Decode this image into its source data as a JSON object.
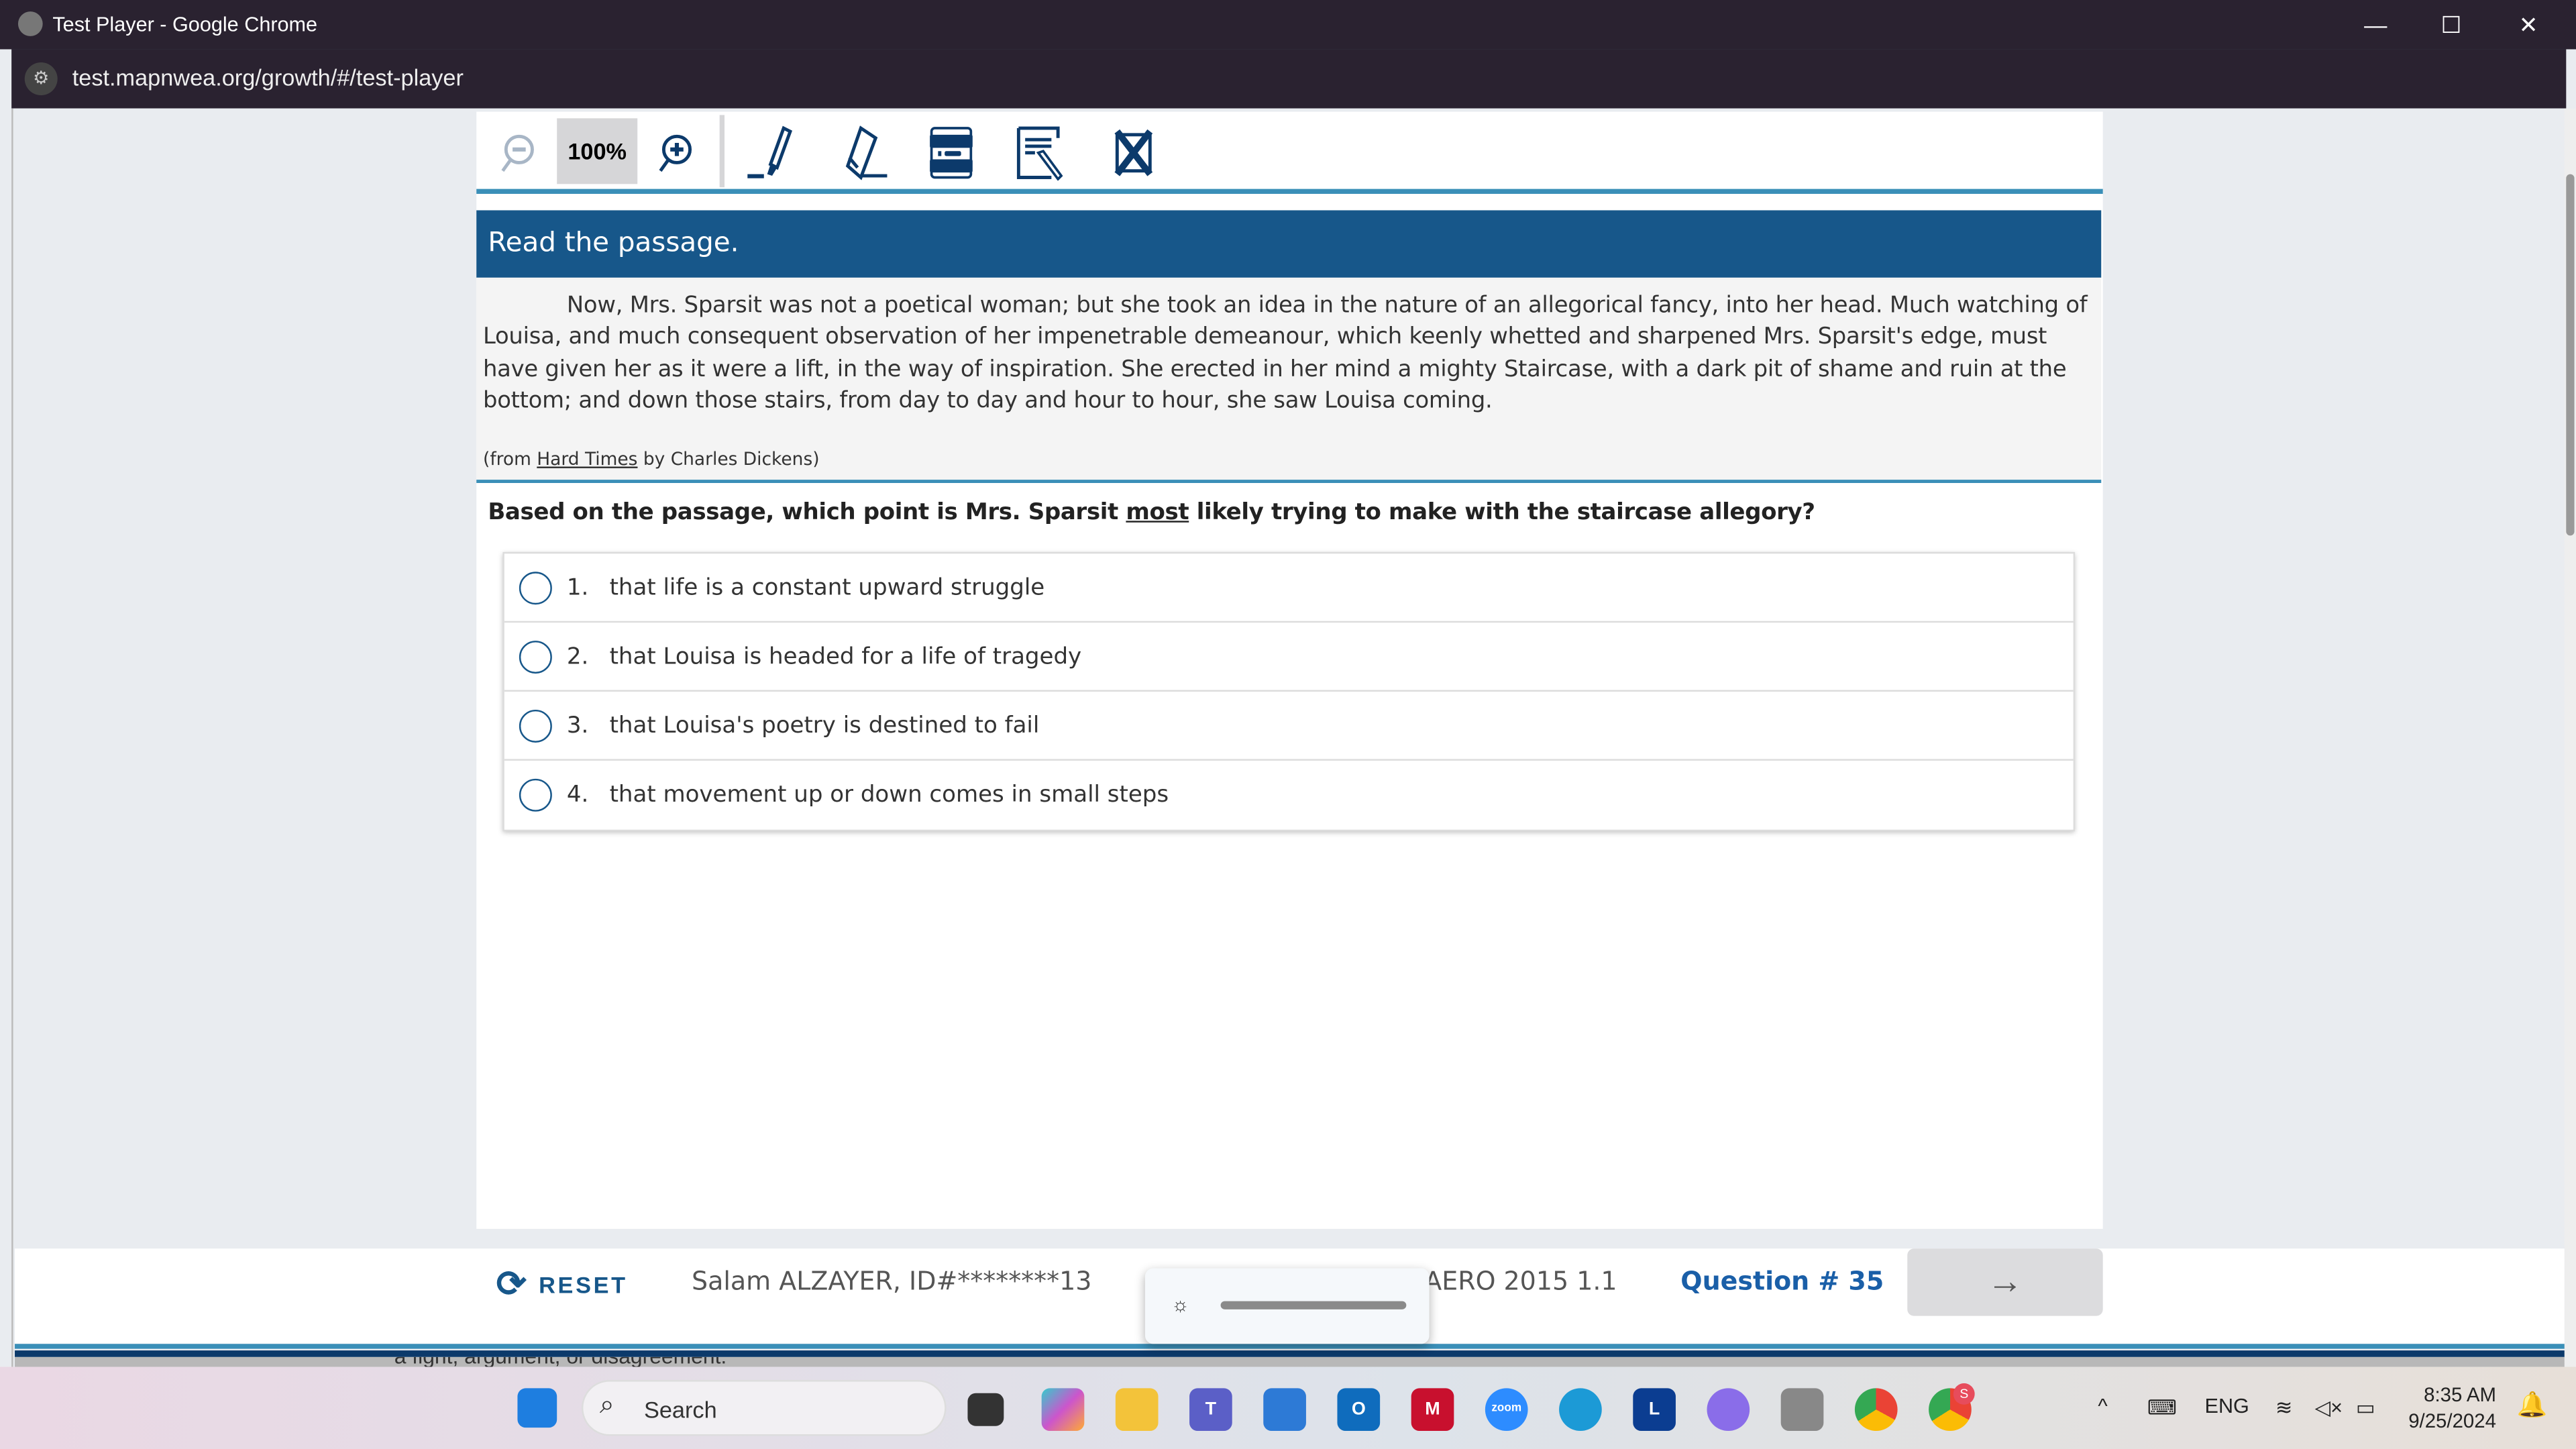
{
  "window": {
    "title": "Test Player - Google Chrome",
    "url": "test.mapnwea.org/growth/#/test-player",
    "minimize": "—",
    "maximize": "☐",
    "close": "✕"
  },
  "toolbar": {
    "zoom_level": "100%",
    "tools": [
      "zoom-out",
      "zoom-in",
      "highlighter",
      "eraser",
      "line-reader",
      "notepad",
      "answer-eliminator"
    ]
  },
  "passage": {
    "header": "Read the passage.",
    "text": "Now, Mrs. Sparsit was not a poetical woman; but she took an idea in the nature of an allegorical fancy, into her head. Much watching of Louisa, and much consequent observation of her impenetrable demeanour, which keenly whetted and sharpened Mrs. Sparsit's edge, must have given her as it were a lift, in the way of inspiration. She erected in her mind a mighty Staircase, with a dark pit of shame and ruin at the bottom; and down those stairs, from day to day and hour to hour, she saw Louisa coming.",
    "citation_prefix": "(from ",
    "citation_title": "Hard Times",
    "citation_suffix": " by Charles Dickens)"
  },
  "question": {
    "before": "Based on the passage, which point is Mrs. Sparsit ",
    "emphasis": "most",
    "after": " likely trying to make with the staircase allegory?",
    "options": [
      {
        "num": "1.",
        "text": "that life is a constant upward struggle",
        "selected": false
      },
      {
        "num": "2.",
        "text": "that Louisa is headed for a life of tragedy",
        "selected": false
      },
      {
        "num": "3.",
        "text": "that Louisa's poetry is destined to fail",
        "selected": false
      },
      {
        "num": "4.",
        "text": "that movement up or down comes in small steps",
        "selected": false
      }
    ]
  },
  "footer": {
    "reset": "RESET",
    "student": "Salam ALZAYER, ID#********13",
    "test_name": "AERO 2015 1.1",
    "question_number": "Question # 35",
    "next": "→"
  },
  "background_text": "a fight, argument, or disagreement.",
  "taskbar": {
    "search": "Search",
    "lang": "ENG",
    "time": "8:35 AM",
    "date": "9/25/2024",
    "zoom_app": "zoom",
    "l_app": "L",
    "badge": "S"
  }
}
